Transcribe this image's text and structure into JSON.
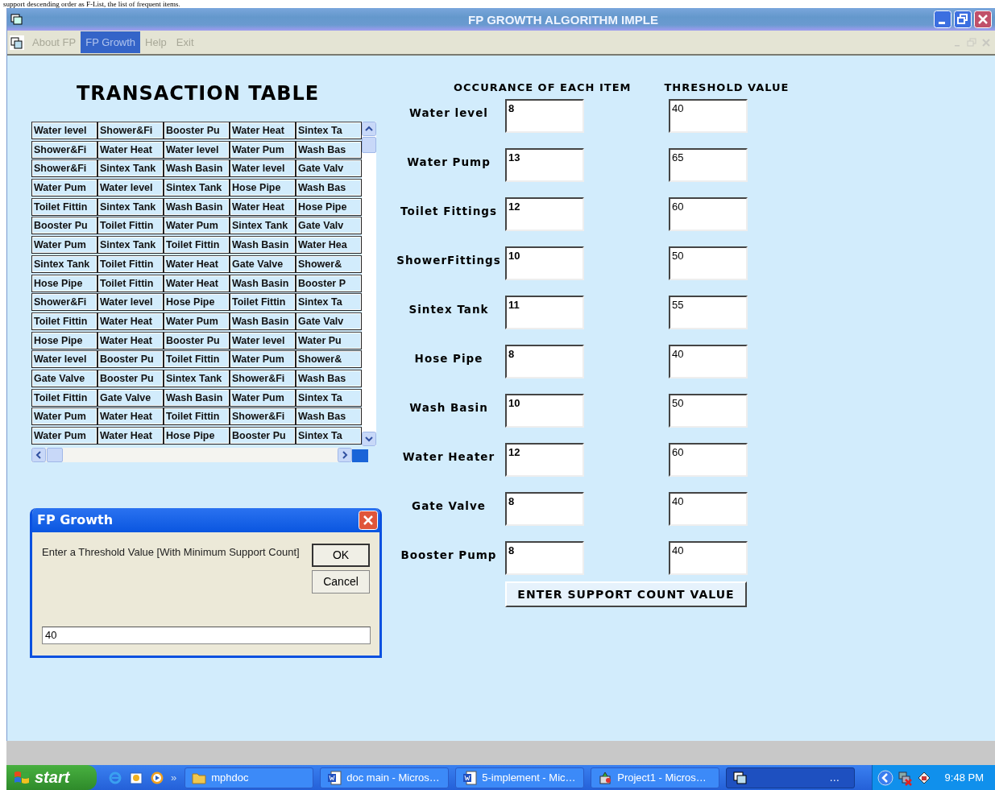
{
  "document_line": "support descending order as F-List, the list of frequent items.",
  "window": {
    "title": "FP GROWTH ALGORITHM IMPLE"
  },
  "menu": [
    {
      "label": "About FP",
      "selected": false
    },
    {
      "label": "FP Growth",
      "selected": true
    },
    {
      "label": "Help",
      "selected": false
    },
    {
      "label": "Exit",
      "selected": false
    }
  ],
  "transaction_table": {
    "title": "TRANSACTION TABLE",
    "rows": [
      [
        "Water level",
        "Shower&Fi",
        "Booster Pu",
        "Water Heat",
        "Sintex Ta"
      ],
      [
        "Shower&Fi",
        "Water Heat",
        "Water level",
        "Water Pum",
        "Wash Bas"
      ],
      [
        "Shower&Fi",
        "Sintex Tank",
        "Wash Basin",
        "Water level",
        "Gate Valv"
      ],
      [
        "Water Pum",
        "Water level",
        "Sintex Tank",
        "Hose Pipe",
        "Wash Bas"
      ],
      [
        "Toilet Fittin",
        "Sintex Tank",
        "Wash Basin",
        "Water Heat",
        "Hose Pipe"
      ],
      [
        "Booster Pu",
        "Toilet Fittin",
        "Water Pum",
        "Sintex Tank",
        "Gate Valv"
      ],
      [
        "Water Pum",
        "Sintex Tank",
        "Toilet Fittin",
        "Wash Basin",
        "Water Hea"
      ],
      [
        "Sintex Tank",
        "Toilet Fittin",
        "Water Heat",
        "Gate Valve",
        "Shower&"
      ],
      [
        "Hose Pipe",
        "Toilet Fittin",
        "Water Heat",
        "Wash Basin",
        "Booster P"
      ],
      [
        "Shower&Fi",
        "Water level",
        "Hose Pipe",
        "Toilet Fittin",
        "Sintex Ta"
      ],
      [
        "Toilet Fittin",
        "Water Heat",
        "Water Pum",
        "Wash Basin",
        "Gate Valv"
      ],
      [
        "Hose Pipe",
        "Water Heat",
        "Booster Pu",
        "Water level",
        "Water Pu"
      ],
      [
        "Water level",
        "Booster Pu",
        "Toilet Fittin",
        "Water Pum",
        "Shower&"
      ],
      [
        "Gate Valve",
        "Booster Pu",
        "Sintex Tank",
        "Shower&Fi",
        "Wash Bas"
      ],
      [
        "Toilet Fittin",
        "Gate Valve",
        "Wash Basin",
        "Water Pum",
        "Sintex Ta"
      ],
      [
        "Water Pum",
        "Water Heat",
        "Toilet Fittin",
        "Shower&Fi",
        "Wash Bas"
      ],
      [
        "Water Pum",
        "Water Heat",
        "Hose Pipe",
        "Booster Pu",
        "Sintex Ta"
      ]
    ]
  },
  "item_table": {
    "headers": [
      "OCCURANCE OF EACH ITEM",
      "THRESHOLD VALUE"
    ],
    "items": [
      {
        "name": "Water level",
        "occurrence": "8",
        "threshold": "40"
      },
      {
        "name": "Water Pump",
        "occurrence": "13",
        "threshold": "65"
      },
      {
        "name": "Toilet Fittings",
        "occurrence": "12",
        "threshold": "60"
      },
      {
        "name": "ShowerFittings",
        "occurrence": "10",
        "threshold": "50"
      },
      {
        "name": "Sintex Tank",
        "occurrence": "11",
        "threshold": "55"
      },
      {
        "name": "Hose Pipe",
        "occurrence": "8",
        "threshold": "40"
      },
      {
        "name": "Wash Basin",
        "occurrence": "10",
        "threshold": "50"
      },
      {
        "name": "Water Heater",
        "occurrence": "12",
        "threshold": "60"
      },
      {
        "name": "Gate Valve",
        "occurrence": "8",
        "threshold": "40"
      },
      {
        "name": "Booster Pump",
        "occurrence": "8",
        "threshold": "40"
      }
    ],
    "button": "ENTER SUPPORT COUNT VALUE"
  },
  "dialog": {
    "title": "FP Growth",
    "prompt": "Enter a Threshold Value [With Minimum Support Count]",
    "buttons": [
      "OK",
      "Cancel"
    ],
    "value": "40"
  },
  "taskbar": {
    "start": "start",
    "chevron": "»",
    "tasks": [
      {
        "label": "mphdoc",
        "kind": "folder",
        "selected": false
      },
      {
        "label": "doc main - Micros…",
        "kind": "word",
        "selected": false
      },
      {
        "label": "5-implement - Mic…",
        "kind": "word",
        "selected": false
      },
      {
        "label": "Project1 - Micros…",
        "kind": "project",
        "selected": false
      },
      {
        "label": "…",
        "kind": "app",
        "selected": true
      }
    ],
    "clock": "9:48 PM"
  }
}
